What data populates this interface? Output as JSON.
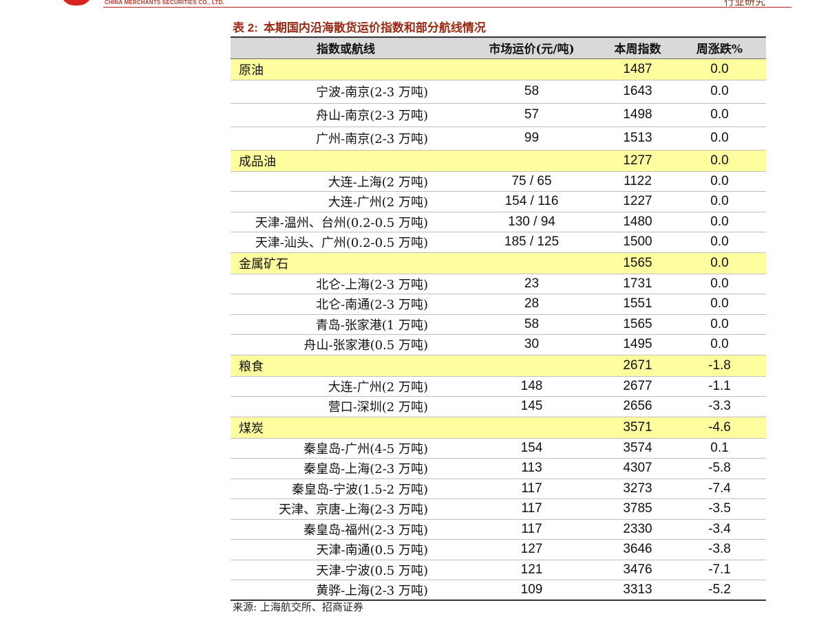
{
  "header": {
    "company_en": "CHINA MERCHANTS SECURITIES CO., LTD.",
    "report_type": "行业研究"
  },
  "table": {
    "title_label": "表 2:",
    "title": "本期国内沿海散货运价指数和部分航线情况",
    "columns": [
      "指数或航线",
      "市场运价(元/吨)",
      "本周指数",
      "周涨跌%"
    ],
    "rows": [
      {
        "type": "category",
        "name": "原油",
        "price": "",
        "index": "1487",
        "change": "0.0"
      },
      {
        "type": "route",
        "name": "宁波-南京(2-3 万吨)",
        "price": "58",
        "index": "1643",
        "change": "0.0"
      },
      {
        "type": "route",
        "name": "舟山-南京(2-3 万吨)",
        "price": "57",
        "index": "1498",
        "change": "0.0"
      },
      {
        "type": "route",
        "name": "广州-南京(2-3 万吨)",
        "price": "99",
        "index": "1513",
        "change": "0.0"
      },
      {
        "type": "category",
        "name": "成品油",
        "price": "",
        "index": "1277",
        "change": "0.0"
      },
      {
        "type": "route",
        "name": "大连-上海(2 万吨)",
        "price": "75 / 65",
        "index": "1122",
        "change": "0.0"
      },
      {
        "type": "route",
        "name": "大连-广州(2 万吨)",
        "price": "154 / 116",
        "index": "1227",
        "change": "0.0"
      },
      {
        "type": "route",
        "name": "天津-温州、台州(0.2-0.5 万吨)",
        "price": "130 / 94",
        "index": "1480",
        "change": "0.0"
      },
      {
        "type": "route",
        "name": "天津-汕头、广州(0.2-0.5 万吨)",
        "price": "185 / 125",
        "index": "1500",
        "change": "0.0"
      },
      {
        "type": "category",
        "name": "金属矿石",
        "price": "",
        "index": "1565",
        "change": "0.0"
      },
      {
        "type": "route",
        "name": "北仑-上海(2-3 万吨)",
        "price": "23",
        "index": "1731",
        "change": "0.0"
      },
      {
        "type": "route",
        "name": "北仑-南通(2-3 万吨)",
        "price": "28",
        "index": "1551",
        "change": "0.0"
      },
      {
        "type": "route",
        "name": "青岛-张家港(1 万吨)",
        "price": "58",
        "index": "1565",
        "change": "0.0"
      },
      {
        "type": "route",
        "name": "舟山-张家港(0.5 万吨)",
        "price": "30",
        "index": "1495",
        "change": "0.0"
      },
      {
        "type": "category",
        "name": "粮食",
        "price": "",
        "index": "2671",
        "change": "-1.8"
      },
      {
        "type": "route",
        "name": "大连-广州(2 万吨)",
        "price": "148",
        "index": "2677",
        "change": "-1.1"
      },
      {
        "type": "route",
        "name": "营口-深圳(2 万吨)",
        "price": "145",
        "index": "2656",
        "change": "-3.3"
      },
      {
        "type": "category",
        "name": "煤炭",
        "price": "",
        "index": "3571",
        "change": "-4.6"
      },
      {
        "type": "route",
        "name": "秦皇岛-广州(4-5 万吨)",
        "price": "154",
        "index": "3574",
        "change": "0.1"
      },
      {
        "type": "route",
        "name": "秦皇岛-上海(2-3 万吨)",
        "price": "113",
        "index": "4307",
        "change": "-5.8"
      },
      {
        "type": "route",
        "name": "秦皇岛-宁波(1.5-2 万吨)",
        "price": "117",
        "index": "3273",
        "change": "-7.4"
      },
      {
        "type": "route",
        "name": "天津、京唐-上海(2-3 万吨)",
        "price": "117",
        "index": "3785",
        "change": "-3.5"
      },
      {
        "type": "route",
        "name": "秦皇岛-福州(2-3 万吨)",
        "price": "117",
        "index": "2330",
        "change": "-3.4"
      },
      {
        "type": "route",
        "name": "天津-南通(0.5 万吨)",
        "price": "127",
        "index": "3646",
        "change": "-3.8"
      },
      {
        "type": "route",
        "name": "天津-宁波(0.5 万吨)",
        "price": "121",
        "index": "3476",
        "change": "-7.1"
      },
      {
        "type": "route",
        "name": "黄骅-上海(2-3 万吨)",
        "price": "109",
        "index": "3313",
        "change": "-5.2"
      }
    ]
  },
  "source": "来源: 上海航交所、招商证券",
  "colors": {
    "category_fill": "#fffe9e",
    "header_fill": "#d9d9d9",
    "title_color": "#9b2a14",
    "brand_red": "#d9241c"
  }
}
